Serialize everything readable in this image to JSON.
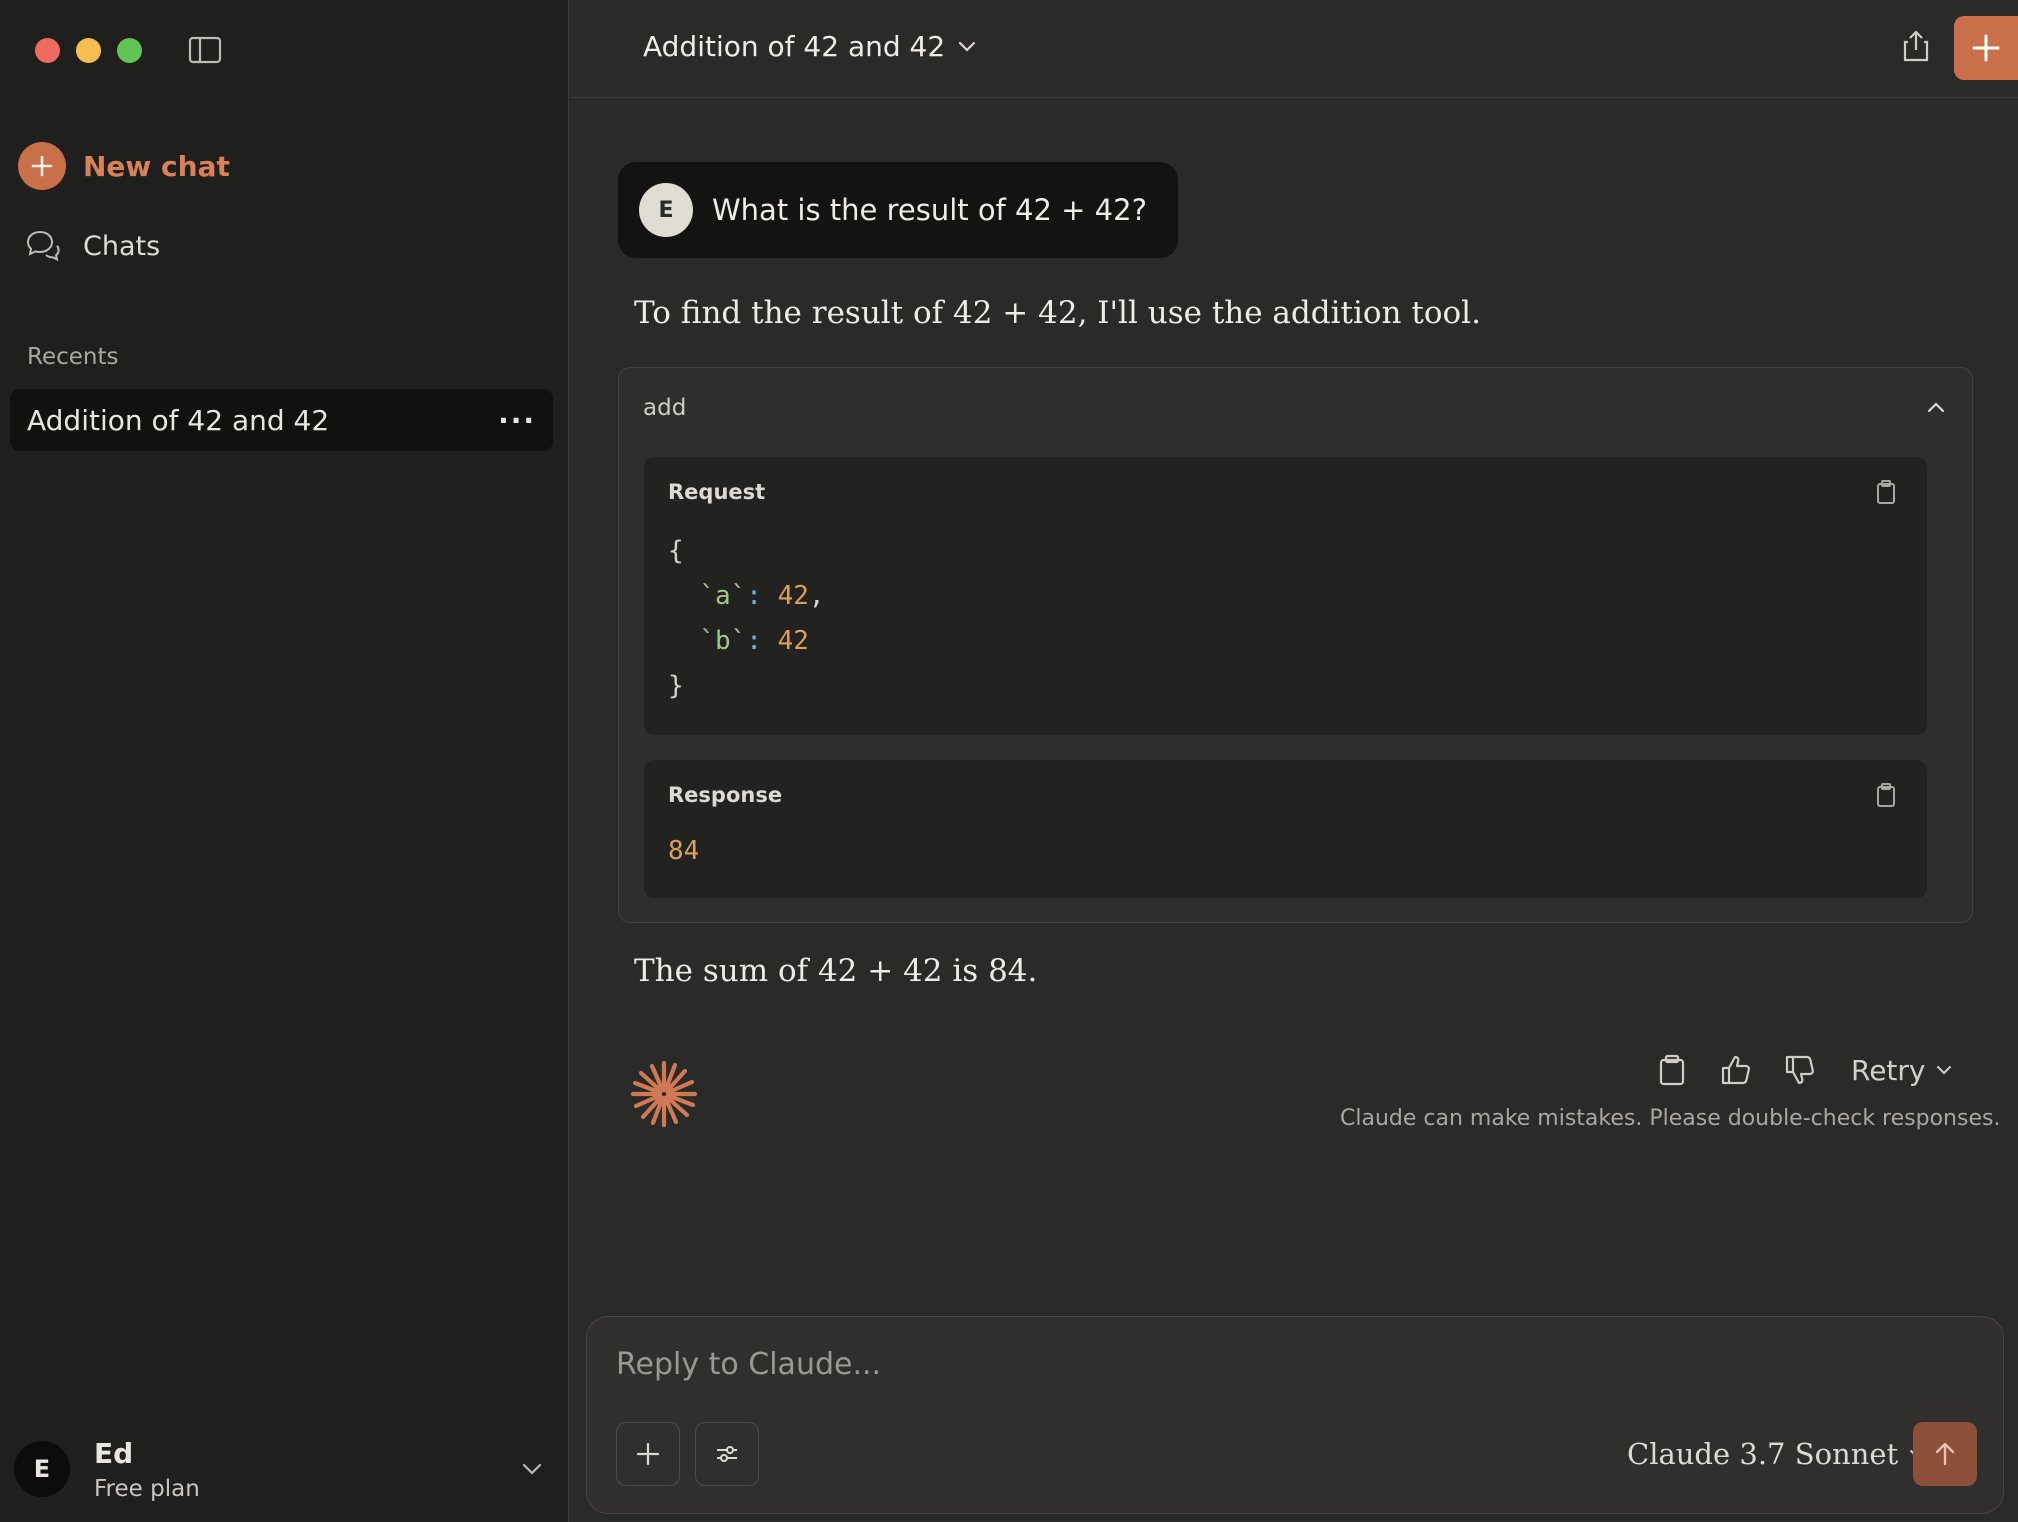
{
  "sidebar": {
    "new_chat_label": "New chat",
    "chats_label": "Chats",
    "recents_heading": "Recents",
    "recents": [
      {
        "label": "Addition of 42 and 42",
        "more": "···"
      }
    ],
    "user": {
      "initial": "E",
      "name": "Ed",
      "plan": "Free plan"
    }
  },
  "header": {
    "title": "Addition of 42 and 42"
  },
  "conversation": {
    "user_message": {
      "initial": "E",
      "text": "What is the result of 42 + 42?"
    },
    "assistant_intro": "To find the result of 42 + 42, I'll use the addition tool.",
    "tool_call": {
      "name": "add",
      "request_label": "Request",
      "request_code": {
        "open": "{",
        "line_a_key": "`a`",
        "line_a_value": "42",
        "line_b_key": "`b`",
        "line_b_value": "42",
        "close": "}"
      },
      "response_label": "Response",
      "response_value": "84"
    },
    "assistant_result": "The sum of 42 + 42 is 84.",
    "retry_label": "Retry",
    "disclaimer": "Claude can make mistakes. Please double-check responses."
  },
  "composer": {
    "placeholder": "Reply to Claude...",
    "model": "Claude 3.7 Sonnet"
  },
  "colors": {
    "accent": "#c96f4a",
    "accent_text": "#d9825a",
    "send_button": "#8c4f38",
    "background": "#2a2a28",
    "sidebar_background": "#1f1f1e"
  },
  "icons": {
    "sidebar_toggle": "sidebar-toggle-icon",
    "new_chat": "plus-icon",
    "chats": "chat-bubbles-icon",
    "share": "share-icon",
    "copy": "clipboard-icon",
    "thumbs_up": "thumbs-up-icon",
    "thumbs_down": "thumbs-down-icon",
    "claude_logo": "claude-starburst-icon",
    "send": "arrow-up-icon"
  }
}
